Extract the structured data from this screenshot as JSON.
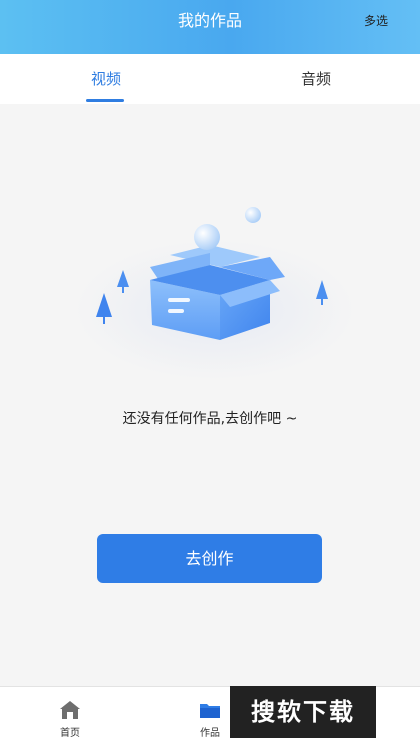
{
  "header": {
    "title": "我的作品",
    "multi_select": "多选"
  },
  "tabs": [
    {
      "label": "视频",
      "active": true
    },
    {
      "label": "音频",
      "active": false
    }
  ],
  "empty_state": {
    "message": "还没有任何作品,去创作吧 ~",
    "icon": "empty-box-illustration"
  },
  "create_button": {
    "label": "去创作"
  },
  "bottom_nav": [
    {
      "label": "首页",
      "icon": "home-icon"
    },
    {
      "label": "作品",
      "icon": "folder-icon",
      "active": true
    }
  ],
  "watermark": {
    "text": "搜软下载"
  },
  "colors": {
    "accent": "#2f7de6",
    "header_start": "#5cc0f2",
    "header_end": "#64bff5"
  }
}
